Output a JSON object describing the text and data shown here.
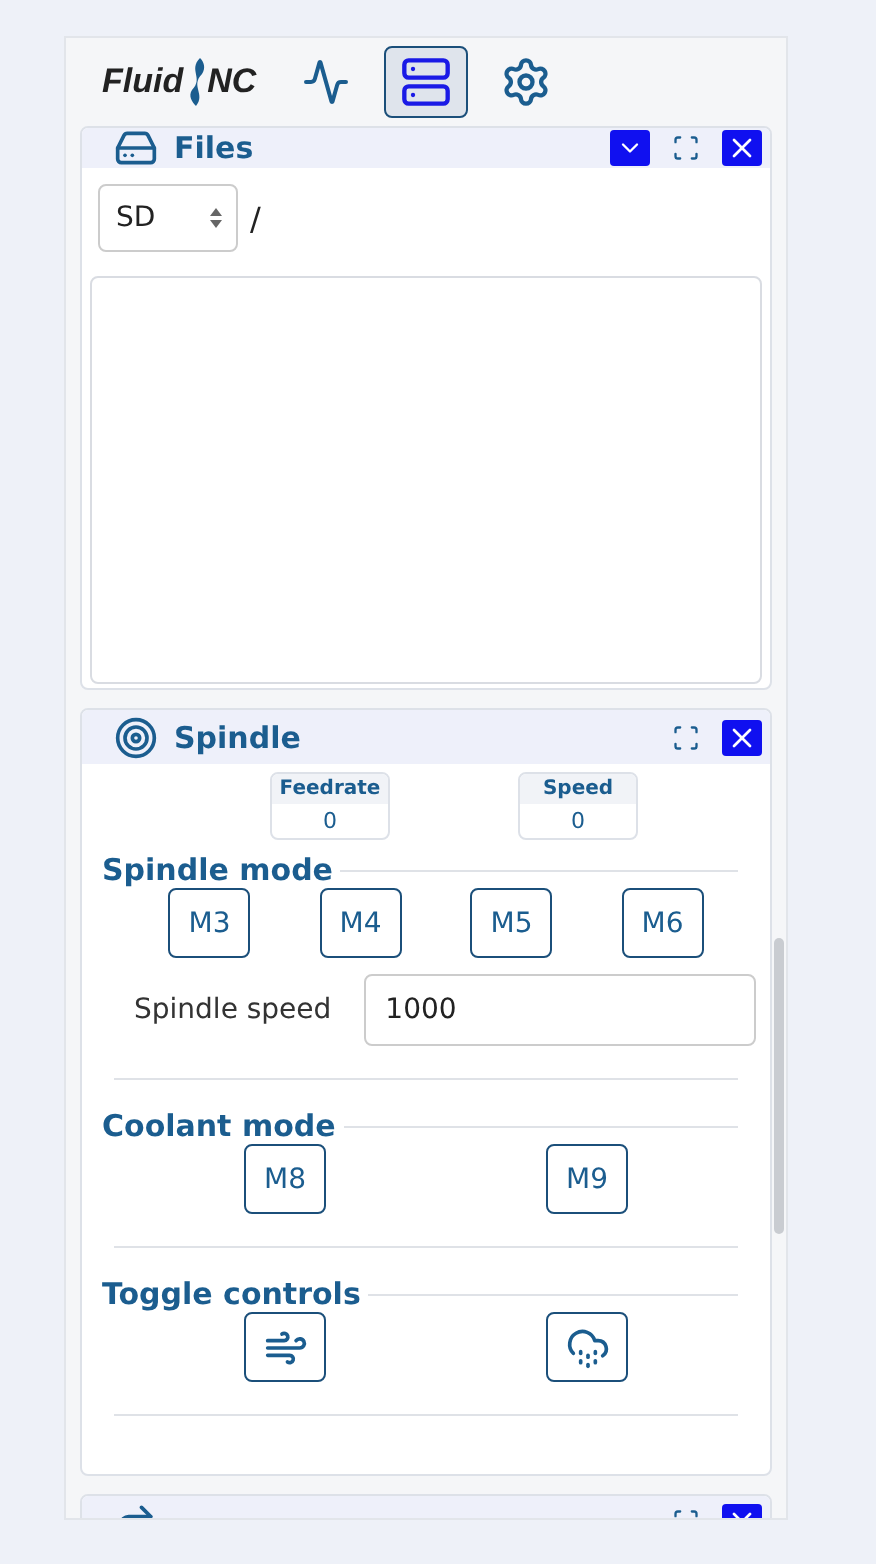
{
  "nav": {
    "logo_left": "Fluid",
    "logo_right": "NC",
    "items": [
      {
        "selected": false
      },
      {
        "selected": true
      },
      {
        "selected": false
      }
    ]
  },
  "files": {
    "title": "Files",
    "storage": "SD",
    "path": "/"
  },
  "spindle": {
    "title": "Spindle",
    "readouts": [
      {
        "label": "Feedrate",
        "value": "0"
      },
      {
        "label": "Speed",
        "value": "0"
      }
    ],
    "sections": [
      {
        "kind": "buttons",
        "title": "Spindle mode",
        "buttons": [
          "M3",
          "M4",
          "M5",
          "M6"
        ]
      },
      {
        "kind": "field",
        "label": "Spindle speed",
        "value": "1000"
      },
      {
        "kind": "buttons",
        "title": "Coolant mode",
        "buttons": [
          "M8",
          "M9"
        ]
      },
      {
        "kind": "icons",
        "title": "Toggle controls"
      }
    ]
  }
}
